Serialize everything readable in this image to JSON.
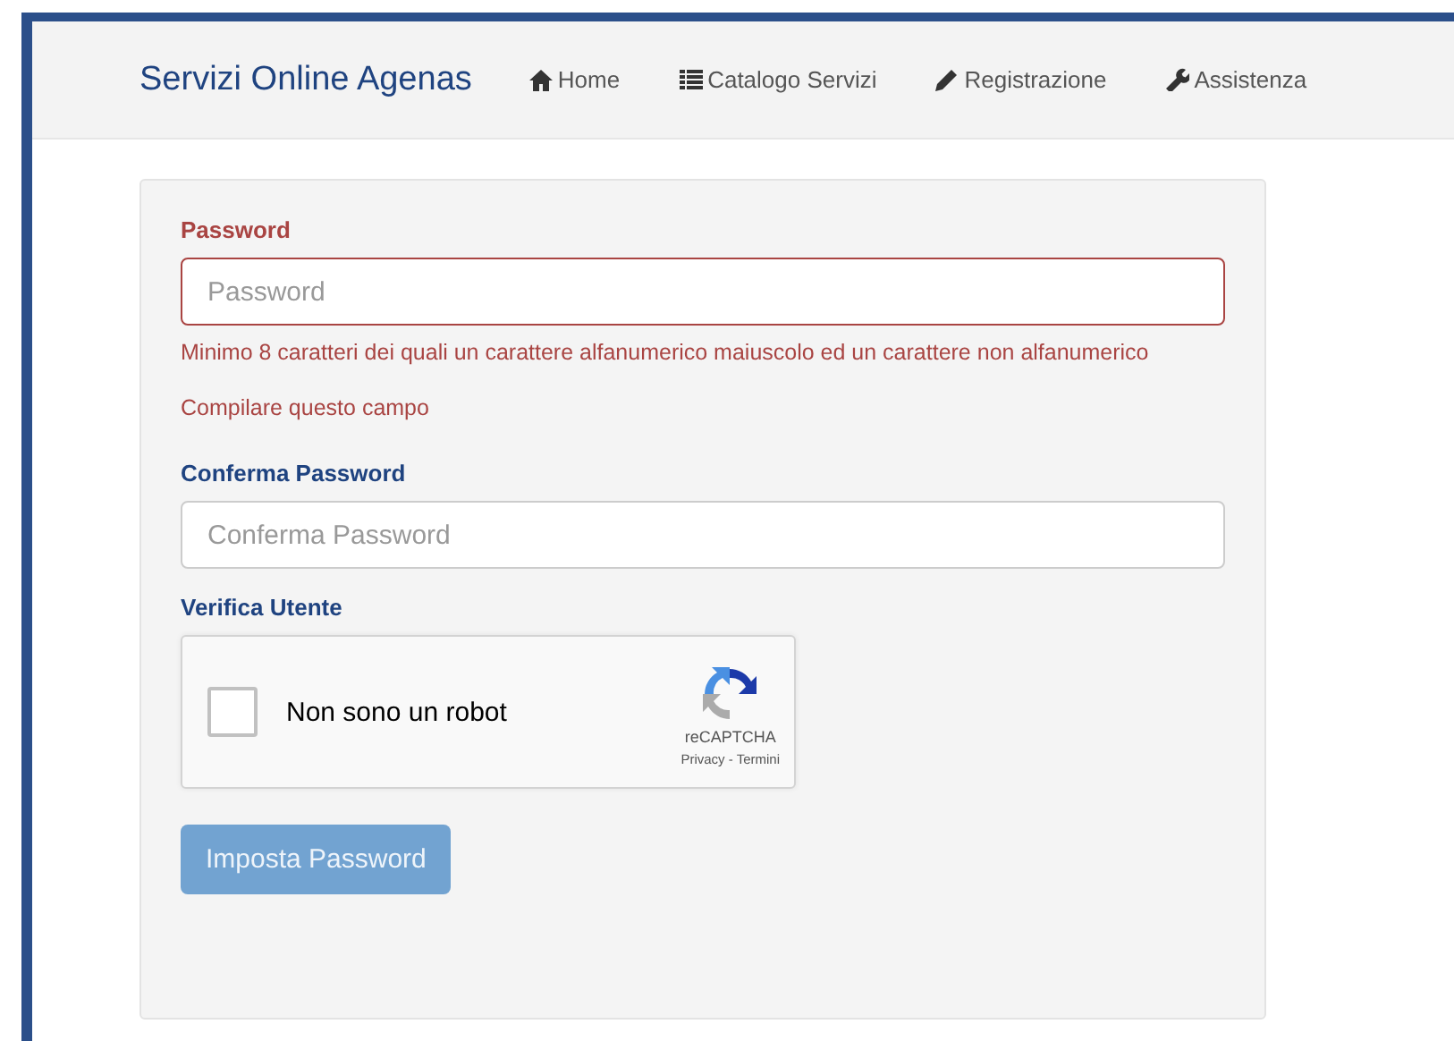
{
  "navbar": {
    "brand": "Servizi Online Agenas",
    "links": [
      {
        "kind": "home",
        "label": "Home"
      },
      {
        "kind": "list",
        "label": "Catalogo Servizi"
      },
      {
        "kind": "pencil",
        "label": "Registrazione"
      },
      {
        "kind": "wrench",
        "label": "Assistenza"
      }
    ]
  },
  "form": {
    "fields": [
      {
        "label": "Password",
        "placeholder": "Password",
        "error": true,
        "messages": [
          "Minimo 8 caratteri dei quali un carattere alfanumerico maiuscolo ed un carattere non alfanumerico",
          "Compilare questo campo"
        ]
      },
      {
        "label": "Conferma Password",
        "placeholder": "Conferma Password",
        "error": false
      }
    ],
    "captcha": {
      "label": "Verifica Utente",
      "checkbox_label": "Non sono un robot",
      "checked": false,
      "brand": "reCAPTCHA",
      "links": "Privacy - Termini"
    },
    "submit": {
      "label": "Imposta Password",
      "disabled": true
    }
  }
}
